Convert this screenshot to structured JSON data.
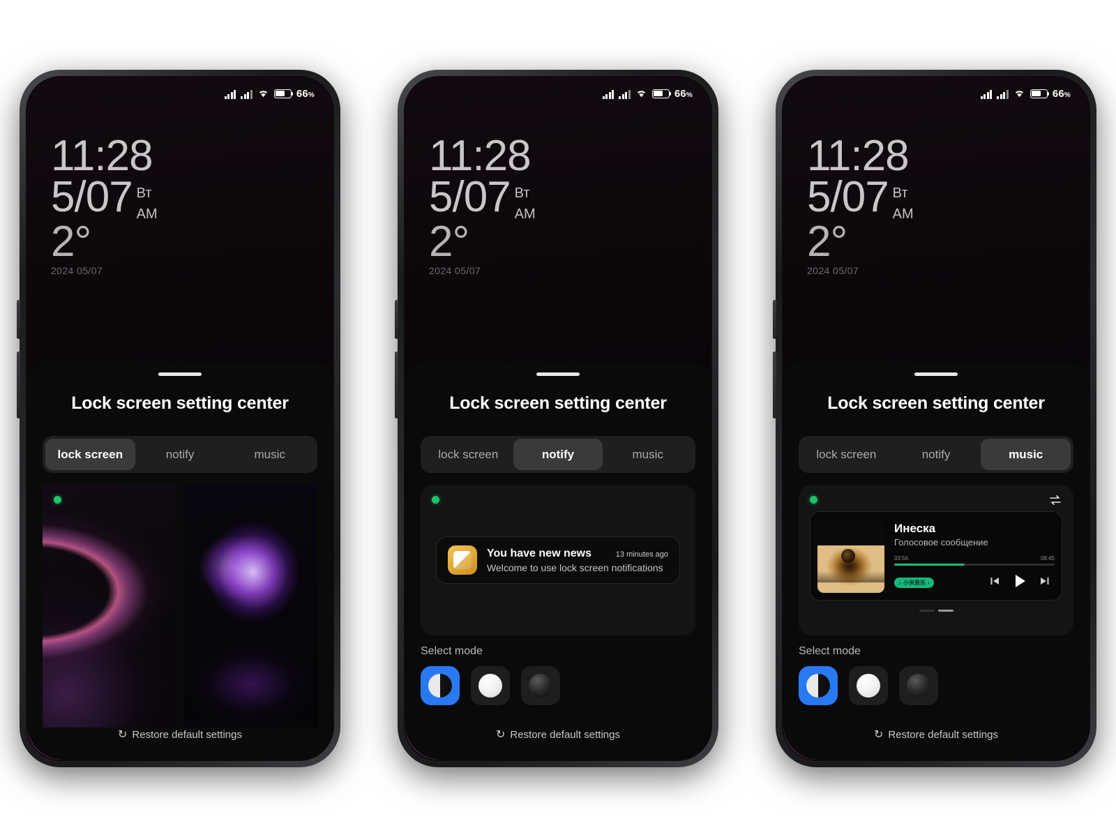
{
  "status_bar": {
    "battery_percent": "66",
    "battery_unit": "%",
    "signal_icon": "cellular-signal-icon",
    "signal_icon_2": "cellular-signal-icon-2",
    "wifi_icon": "wifi-icon",
    "battery_icon": "battery-icon"
  },
  "lockscreen": {
    "time": "11:28",
    "date_short": "5/07",
    "weekday": "Вт",
    "meridiem": "AM",
    "temperature": "2°",
    "date_full": "2024 05/07"
  },
  "sheet": {
    "title": "Lock screen setting center",
    "grabber": "drag-handle",
    "tabs": [
      {
        "id": "lock-screen",
        "label": "lock screen"
      },
      {
        "id": "notify",
        "label": "notify"
      },
      {
        "id": "music",
        "label": "music"
      }
    ],
    "select_mode_label": "Select mode",
    "modes": [
      {
        "id": "auto",
        "icon": "half-circle-icon"
      },
      {
        "id": "light",
        "icon": "light-circle-icon"
      },
      {
        "id": "dark",
        "icon": "dark-circle-icon"
      }
    ],
    "restore_label": "Restore default settings",
    "restore_icon": "refresh-icon",
    "accent_selected": "#2979f2"
  },
  "phones": [
    {
      "id": "phone-lock-screen",
      "active_tab": "lock screen",
      "active_mode": 0
    },
    {
      "id": "phone-notify",
      "active_tab": "notify",
      "active_mode": 0
    },
    {
      "id": "phone-music",
      "active_tab": "music",
      "active_mode": 0
    }
  ],
  "wallpapers": {
    "thumb_1_name": "pink-ribbon-wallpaper",
    "thumb_2_name": "purple-lightpainting-wallpaper",
    "selected_indicator": "selected-dot"
  },
  "notification": {
    "app_icon": "news-app-icon",
    "title": "You have new news",
    "time": "13 minutes ago",
    "subtitle": "Welcome to use lock screen notifications",
    "status_dot": "active-dot"
  },
  "music_player": {
    "status_dot": "active-dot",
    "swap_icon": "transfer-arrows-icon",
    "cover_art": "eye-album-art",
    "song": "Инеска",
    "artist": "Голосовое сообщение",
    "elapsed": "03:56",
    "duration": "08:45",
    "progress_percent": 44,
    "progress_color": "#17c07a",
    "app_badge": "小米音乐",
    "app_badge_icon": "music-note-icon",
    "prev_icon": "previous-track-icon",
    "play_icon": "play-icon",
    "next_icon": "next-track-icon",
    "page_dots": 2,
    "page_active": 1
  }
}
